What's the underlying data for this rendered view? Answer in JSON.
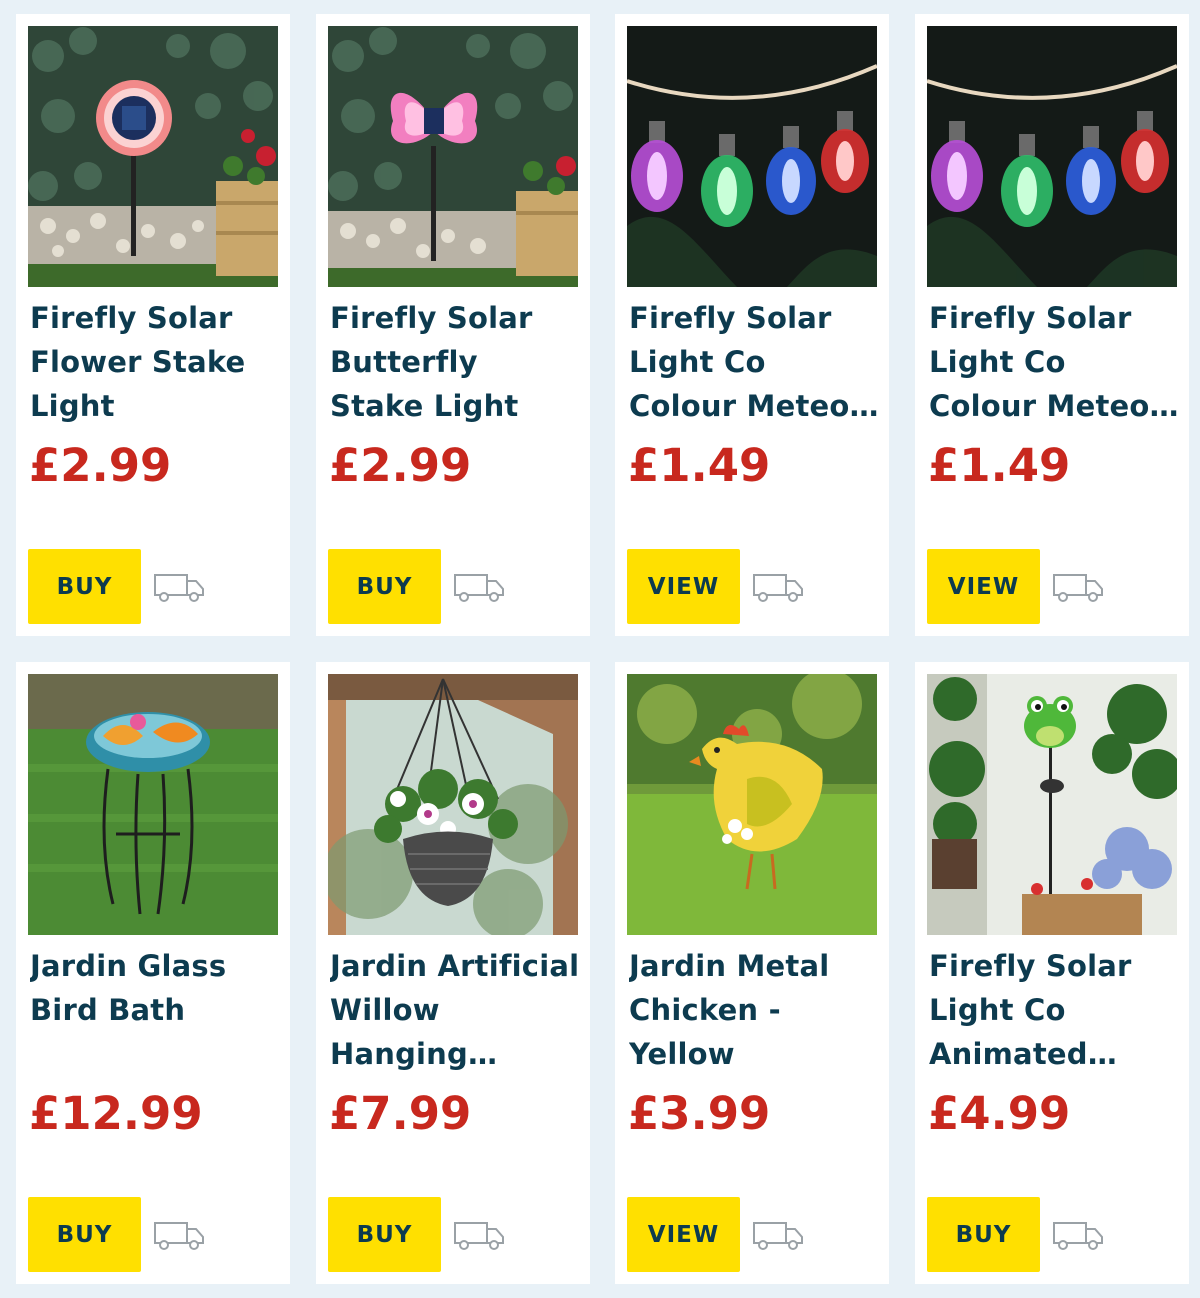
{
  "products": [
    {
      "title": "Firefly Solar Flower Stake Light",
      "price": "£2.99",
      "action": "BUY",
      "image": "solar-flower-stake"
    },
    {
      "title": "Firefly Solar Butterfly Stake Light",
      "price": "£2.99",
      "action": "BUY",
      "image": "solar-butterfly-stake"
    },
    {
      "title": "Firefly Solar Light Co Colour Meteor Show...",
      "price": "£1.49",
      "action": "VIEW",
      "image": "colour-bulbs"
    },
    {
      "title": "Firefly Solar Light Co Colour Meteor Show...",
      "price": "£1.49",
      "action": "VIEW",
      "image": "colour-bulbs"
    },
    {
      "title": "Jardin Glass Bird Bath",
      "price": "£12.99",
      "action": "BUY",
      "image": "bird-bath"
    },
    {
      "title": "Jardin Artificial Willow Hanging Basket - Pink",
      "price": "£7.99",
      "action": "BUY",
      "image": "hanging-basket"
    },
    {
      "title": "Jardin Metal Chicken - Yellow",
      "price": "£3.99",
      "action": "VIEW",
      "image": "metal-chicken"
    },
    {
      "title": "Firefly Solar Light Co Animated Eye...",
      "price": "£4.99",
      "action": "BUY",
      "image": "frog-stake"
    }
  ],
  "icons": {
    "delivery": "delivery-van-icon"
  },
  "colors": {
    "price": "#c8281e",
    "button": "#ffe000",
    "title": "#0d3b4f",
    "background": "#e8f1f7"
  }
}
